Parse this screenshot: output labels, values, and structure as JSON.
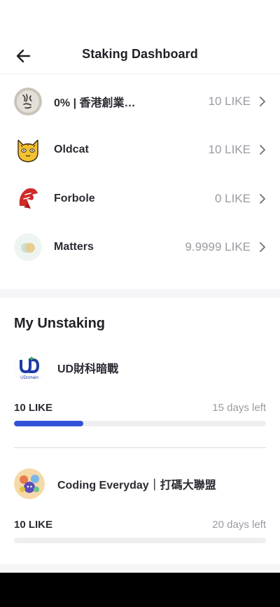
{
  "header": {
    "title": "Staking Dashboard"
  },
  "validators": [
    {
      "name": "0% | 香港創業…",
      "amount": "10 LIKE",
      "avatar": "calligraphy-avatar"
    },
    {
      "name": "Oldcat",
      "amount": "10 LIKE",
      "avatar": "cat-avatar"
    },
    {
      "name": "Forbole",
      "amount": "0 LIKE",
      "avatar": "forbole-logo"
    },
    {
      "name": "Matters",
      "amount": "9.9999 LIKE",
      "avatar": "matters-logo"
    }
  ],
  "unstaking": {
    "title": "My Unstaking",
    "items": [
      {
        "name": "UD財科暗戰",
        "logo_text": "UDomain",
        "amount": "10 LIKE",
        "time_left": "15 days left",
        "progress": 0.275
      },
      {
        "name": "Coding Everyday｜打碼大聯盟",
        "amount": "10 LIKE",
        "time_left": "20 days left",
        "progress": 0
      }
    ]
  },
  "colors": {
    "accent": "#3351d8",
    "muted": "#9a9aa3",
    "track": "#efeff2"
  }
}
